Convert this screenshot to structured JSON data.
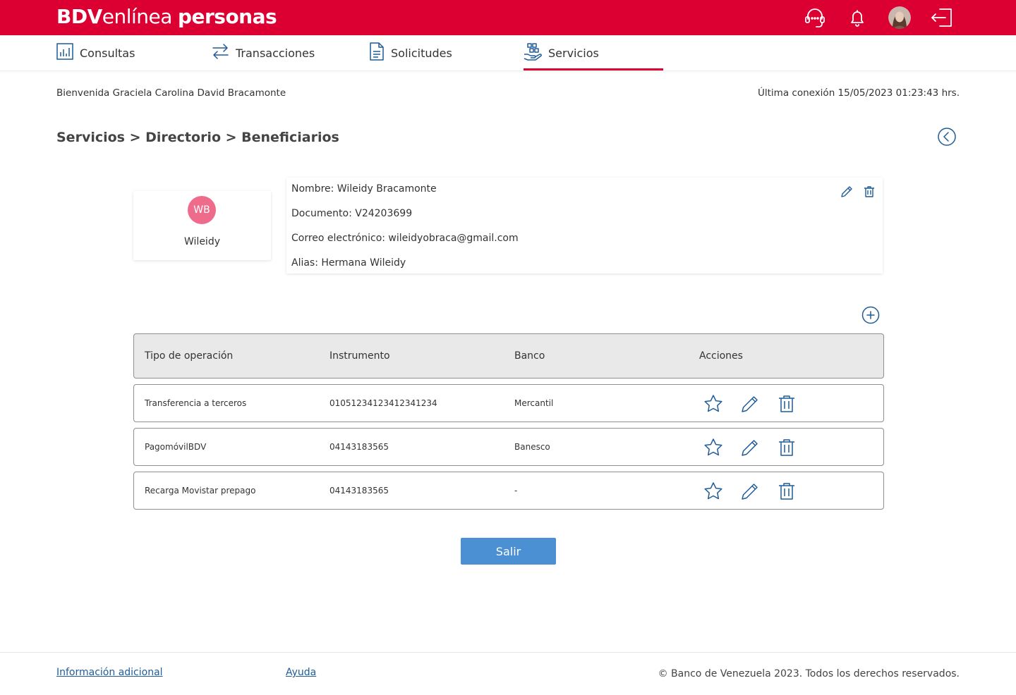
{
  "colors": {
    "brand_red": "#DC0032",
    "accent_blue": "#1F5C99",
    "button_blue": "#4A90D2",
    "avatar_pink": "#EE6B8B"
  },
  "header": {
    "brand_part1": "BDV",
    "brand_part2": "enlínea",
    "brand_part3": "personas",
    "icons": [
      "support-headset-icon",
      "bell-icon",
      "user-avatar",
      "logout-icon"
    ]
  },
  "nav": {
    "items": [
      {
        "label": "Consultas",
        "icon": "chart-icon"
      },
      {
        "label": "Transacciones",
        "icon": "transfer-arrows-icon"
      },
      {
        "label": "Solicitudes",
        "icon": "document-icon"
      },
      {
        "label": "Servicios",
        "icon": "services-hand-icon",
        "active": true
      }
    ]
  },
  "welcome": {
    "greeting": "Bienvenida Graciela Carolina David Bracamonte",
    "last_connection": "Última conexión 15/05/2023 01:23:43 hrs."
  },
  "breadcrumb": "Servicios > Directorio > Beneficiarios",
  "profile": {
    "initials": "WB",
    "name": "Wileidy"
  },
  "details": {
    "nombre": "Nombre: Wileidy Bracamonte",
    "documento": "Documento: V24203699",
    "correo": "Correo electrónico: wileidyobraca@gmail.com",
    "alias": "Alias: Hermana Wileidy"
  },
  "table": {
    "headers": [
      "Tipo de operación",
      "Instrumento",
      "Banco",
      "Acciones"
    ],
    "rows": [
      {
        "tipo": "Transferencia a terceros",
        "instrumento": "01051234123412341234",
        "banco": "Mercantil"
      },
      {
        "tipo": "PagomóvilBDV",
        "instrumento": "04143183565",
        "banco": "Banesco"
      },
      {
        "tipo": "Recarga Movistar prepago",
        "instrumento": "04143183565",
        "banco": "-"
      }
    ]
  },
  "button": {
    "salir": "Salir"
  },
  "footer": {
    "info": "Información adicional",
    "ayuda": "Ayuda",
    "copyright": "© Banco de Venezuela 2023. Todos los derechos reservados."
  }
}
